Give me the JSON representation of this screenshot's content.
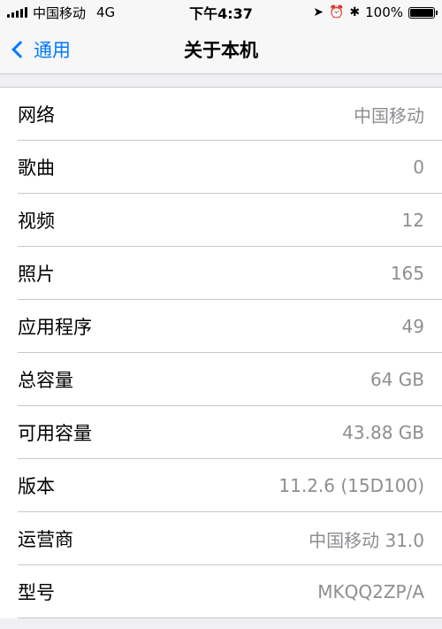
{
  "status_bar": {
    "carrier": "中国移动",
    "network": "4G",
    "time": "下午4:37",
    "battery": "100%",
    "icons": [
      "location-arrow-icon",
      "alarm-icon",
      "bluetooth-icon",
      "battery-icon"
    ]
  },
  "nav": {
    "back_label": "通用",
    "title": "关于本机"
  },
  "rows": [
    {
      "label": "网络",
      "value": "中国移动"
    },
    {
      "label": "歌曲",
      "value": "0"
    },
    {
      "label": "视频",
      "value": "12"
    },
    {
      "label": "照片",
      "value": "165"
    },
    {
      "label": "应用程序",
      "value": "49"
    },
    {
      "label": "总容量",
      "value": "64 GB"
    },
    {
      "label": "可用容量",
      "value": "43.88 GB"
    },
    {
      "label": "版本",
      "value": "11.2.6 (15D100)"
    },
    {
      "label": "运营商",
      "value": "中国移动 31.0"
    },
    {
      "label": "型号",
      "value": "MKQQ2ZP/A"
    }
  ],
  "colors": {
    "accent": "#007aff",
    "secondary_text": "#8e8e93",
    "background": "#efeff4",
    "separator": "#c8c7cc"
  }
}
